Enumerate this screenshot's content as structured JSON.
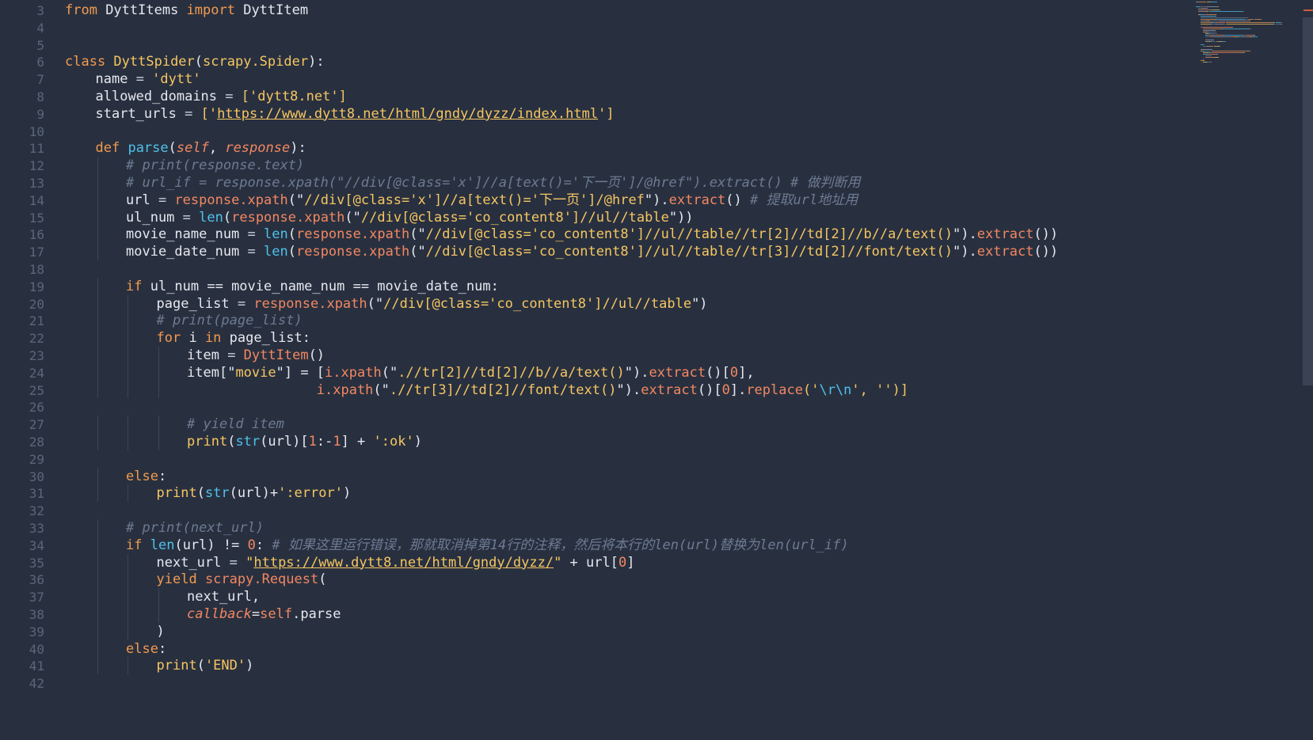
{
  "editor": {
    "language": "python",
    "theme_colors": {
      "background": "#283040",
      "keyword": "#f39a4c",
      "string": "#f6c660",
      "function": "#4fc1e9",
      "comment": "#6d7a91",
      "number": "#f38760",
      "line_number": "#5b6679"
    },
    "lines": [
      {
        "n": "3",
        "tokens": [
          {
            "t": "from",
            "c": "kw"
          },
          {
            "t": " DyttItems ",
            "c": "plain"
          },
          {
            "t": "import",
            "c": "kw"
          },
          {
            "t": " DyttItem",
            "c": "plain"
          }
        ]
      },
      {
        "n": "4",
        "tokens": []
      },
      {
        "n": "5",
        "tokens": []
      },
      {
        "n": "6",
        "tokens": [
          {
            "t": "class",
            "c": "kw"
          },
          {
            "t": " DyttSpider",
            "c": "cls"
          },
          {
            "t": "(",
            "c": "plain"
          },
          {
            "t": "scrapy.Spider",
            "c": "cls"
          },
          {
            "t": "):",
            "c": "plain"
          }
        ]
      },
      {
        "n": "7",
        "indent": 1,
        "tokens": [
          {
            "t": "name",
            "c": "plain"
          },
          {
            "t": " = ",
            "c": "op"
          },
          {
            "t": "'dytt'",
            "c": "str"
          }
        ]
      },
      {
        "n": "8",
        "indent": 1,
        "tokens": [
          {
            "t": "allowed_domains",
            "c": "plain"
          },
          {
            "t": " = ",
            "c": "op"
          },
          {
            "t": "['",
            "c": "str"
          },
          {
            "t": "dytt8.net",
            "c": "str"
          },
          {
            "t": "']",
            "c": "str"
          }
        ]
      },
      {
        "n": "9",
        "indent": 1,
        "tokens": [
          {
            "t": "start_urls",
            "c": "plain"
          },
          {
            "t": " = ",
            "c": "op"
          },
          {
            "t": "['",
            "c": "str"
          },
          {
            "t": "https://www.dytt8.net/html/gndy/dyzz/index.html",
            "c": "url"
          },
          {
            "t": "']",
            "c": "str"
          }
        ]
      },
      {
        "n": "10",
        "tokens": []
      },
      {
        "n": "11",
        "indent": 1,
        "tokens": [
          {
            "t": "def",
            "c": "kw"
          },
          {
            "t": " parse",
            "c": "fn"
          },
          {
            "t": "(",
            "c": "plain"
          },
          {
            "t": "self",
            "c": "self"
          },
          {
            "t": ", ",
            "c": "plain"
          },
          {
            "t": "response",
            "c": "self"
          },
          {
            "t": "):",
            "c": "plain"
          }
        ]
      },
      {
        "n": "12",
        "indent": 2,
        "tokens": [
          {
            "t": "# print(response.text)",
            "c": "cm"
          }
        ]
      },
      {
        "n": "13",
        "indent": 2,
        "tokens": [
          {
            "t": "# url_if = response.xpath(\"//div[@class='x']//a[text()='下一页']/@href\").extract() # 做判断用",
            "c": "cm"
          }
        ]
      },
      {
        "n": "14",
        "indent": 2,
        "tokens": [
          {
            "t": "url",
            "c": "plain"
          },
          {
            "t": " = ",
            "c": "op"
          },
          {
            "t": "response.xpath",
            "c": "call"
          },
          {
            "t": "(\"",
            "c": "plain"
          },
          {
            "t": "//div[@class='x']//a[text()='下一页']/@href",
            "c": "str"
          },
          {
            "t": "\").",
            "c": "plain"
          },
          {
            "t": "extract",
            "c": "call"
          },
          {
            "t": "() ",
            "c": "plain"
          },
          {
            "t": "# 提取url地址用",
            "c": "cm"
          }
        ]
      },
      {
        "n": "15",
        "indent": 2,
        "tokens": [
          {
            "t": "ul_num",
            "c": "plain"
          },
          {
            "t": " = ",
            "c": "op"
          },
          {
            "t": "len",
            "c": "bi"
          },
          {
            "t": "(",
            "c": "plain"
          },
          {
            "t": "response.xpath",
            "c": "call"
          },
          {
            "t": "(\"",
            "c": "plain"
          },
          {
            "t": "//div[@class='co_content8']//ul//table",
            "c": "str"
          },
          {
            "t": "\"))",
            "c": "plain"
          }
        ]
      },
      {
        "n": "16",
        "indent": 2,
        "tokens": [
          {
            "t": "movie_name_num",
            "c": "plain"
          },
          {
            "t": " = ",
            "c": "op"
          },
          {
            "t": "len",
            "c": "bi"
          },
          {
            "t": "(",
            "c": "plain"
          },
          {
            "t": "response.xpath",
            "c": "call"
          },
          {
            "t": "(\"",
            "c": "plain"
          },
          {
            "t": "//div[@class='co_content8']//ul//table//tr[2]//td[2]//b//a/text()",
            "c": "str"
          },
          {
            "t": "\").",
            "c": "plain"
          },
          {
            "t": "extract",
            "c": "call"
          },
          {
            "t": "())",
            "c": "plain"
          }
        ]
      },
      {
        "n": "17",
        "indent": 2,
        "tokens": [
          {
            "t": "movie_date_num",
            "c": "plain"
          },
          {
            "t": " = ",
            "c": "op"
          },
          {
            "t": "len",
            "c": "bi"
          },
          {
            "t": "(",
            "c": "plain"
          },
          {
            "t": "response.xpath",
            "c": "call"
          },
          {
            "t": "(\"",
            "c": "plain"
          },
          {
            "t": "//div[@class='co_content8']//ul//table//tr[3]//td[2]//font/text()",
            "c": "str"
          },
          {
            "t": "\").",
            "c": "plain"
          },
          {
            "t": "extract",
            "c": "call"
          },
          {
            "t": "())",
            "c": "plain"
          }
        ]
      },
      {
        "n": "18",
        "tokens": []
      },
      {
        "n": "19",
        "indent": 2,
        "tokens": [
          {
            "t": "if",
            "c": "kw"
          },
          {
            "t": " ul_num == movie_name_num == movie_date_num:",
            "c": "plain"
          }
        ]
      },
      {
        "n": "20",
        "indent": 3,
        "tokens": [
          {
            "t": "page_list",
            "c": "plain"
          },
          {
            "t": " = ",
            "c": "op"
          },
          {
            "t": "response.xpath",
            "c": "call"
          },
          {
            "t": "(\"",
            "c": "plain"
          },
          {
            "t": "//div[@class='co_content8']//ul//table",
            "c": "str"
          },
          {
            "t": "\")",
            "c": "plain"
          }
        ]
      },
      {
        "n": "21",
        "indent": 3,
        "tokens": [
          {
            "t": "# print(page_list)",
            "c": "cm"
          }
        ]
      },
      {
        "n": "22",
        "indent": 3,
        "tokens": [
          {
            "t": "for",
            "c": "kw"
          },
          {
            "t": " i ",
            "c": "plain"
          },
          {
            "t": "in",
            "c": "kw"
          },
          {
            "t": " page_list:",
            "c": "plain"
          }
        ]
      },
      {
        "n": "23",
        "indent": 4,
        "tokens": [
          {
            "t": "item",
            "c": "plain"
          },
          {
            "t": " = ",
            "c": "op"
          },
          {
            "t": "DyttItem",
            "c": "call"
          },
          {
            "t": "()",
            "c": "plain"
          }
        ]
      },
      {
        "n": "24",
        "indent": 4,
        "tokens": [
          {
            "t": "item",
            "c": "plain"
          },
          {
            "t": "[\"",
            "c": "plain"
          },
          {
            "t": "movie",
            "c": "str"
          },
          {
            "t": "\"] = [",
            "c": "plain"
          },
          {
            "t": "i.xpath",
            "c": "call"
          },
          {
            "t": "(\"",
            "c": "plain"
          },
          {
            "t": ".//tr[2]//td[2]//b//a/text()",
            "c": "str"
          },
          {
            "t": "\").",
            "c": "plain"
          },
          {
            "t": "extract",
            "c": "call"
          },
          {
            "t": "()[",
            "c": "plain"
          },
          {
            "t": "0",
            "c": "num"
          },
          {
            "t": "],",
            "c": "plain"
          }
        ]
      },
      {
        "n": "25",
        "indent": 4,
        "extra": "                ",
        "tokens": [
          {
            "t": "i.xpath",
            "c": "call"
          },
          {
            "t": "(\"",
            "c": "plain"
          },
          {
            "t": ".//tr[3]//td[2]//font/text()",
            "c": "str"
          },
          {
            "t": "\").",
            "c": "plain"
          },
          {
            "t": "extract",
            "c": "call"
          },
          {
            "t": "()[",
            "c": "plain"
          },
          {
            "t": "0",
            "c": "num"
          },
          {
            "t": "].",
            "c": "plain"
          },
          {
            "t": "replace",
            "c": "call"
          },
          {
            "t": "('",
            "c": "str"
          },
          {
            "t": "\\r\\n",
            "c": "esc"
          },
          {
            "t": "', '')]",
            "c": "str"
          }
        ]
      },
      {
        "n": "26",
        "tokens": []
      },
      {
        "n": "27",
        "indent": 4,
        "tokens": [
          {
            "t": "# yield item",
            "c": "cm"
          }
        ]
      },
      {
        "n": "28",
        "indent": 4,
        "tokens": [
          {
            "t": "print",
            "c": "str"
          },
          {
            "t": "(",
            "c": "plain"
          },
          {
            "t": "str",
            "c": "bi"
          },
          {
            "t": "(url)[",
            "c": "plain"
          },
          {
            "t": "1",
            "c": "num"
          },
          {
            "t": ":-",
            "c": "plain"
          },
          {
            "t": "1",
            "c": "num"
          },
          {
            "t": "] + ",
            "c": "plain"
          },
          {
            "t": "':ok'",
            "c": "str"
          },
          {
            "t": ")",
            "c": "plain"
          }
        ]
      },
      {
        "n": "29",
        "tokens": []
      },
      {
        "n": "30",
        "indent": 2,
        "tokens": [
          {
            "t": "else",
            "c": "kw"
          },
          {
            "t": ":",
            "c": "plain"
          }
        ]
      },
      {
        "n": "31",
        "indent": 3,
        "tokens": [
          {
            "t": "print",
            "c": "str"
          },
          {
            "t": "(",
            "c": "plain"
          },
          {
            "t": "str",
            "c": "bi"
          },
          {
            "t": "(url)+",
            "c": "plain"
          },
          {
            "t": "':error'",
            "c": "str"
          },
          {
            "t": ")",
            "c": "plain"
          }
        ]
      },
      {
        "n": "32",
        "tokens": []
      },
      {
        "n": "33",
        "indent": 2,
        "tokens": [
          {
            "t": "# print(next_url)",
            "c": "cm"
          }
        ]
      },
      {
        "n": "34",
        "indent": 2,
        "tokens": [
          {
            "t": "if",
            "c": "kw"
          },
          {
            "t": " ",
            "c": "plain"
          },
          {
            "t": "len",
            "c": "bi"
          },
          {
            "t": "(url) != ",
            "c": "plain"
          },
          {
            "t": "0",
            "c": "num"
          },
          {
            "t": ": ",
            "c": "plain"
          },
          {
            "t": "# 如果这里运行错误，那就取消掉第14行的注释，然后将本行的len(url)替换为len(url_if)",
            "c": "cm"
          }
        ]
      },
      {
        "n": "35",
        "indent": 3,
        "tokens": [
          {
            "t": "next_url",
            "c": "plain"
          },
          {
            "t": " = ",
            "c": "op"
          },
          {
            "t": "\"",
            "c": "str"
          },
          {
            "t": "https://www.dytt8.net/html/gndy/dyzz/",
            "c": "url"
          },
          {
            "t": "\"",
            "c": "str"
          },
          {
            "t": " + url[",
            "c": "plain"
          },
          {
            "t": "0",
            "c": "num"
          },
          {
            "t": "]",
            "c": "plain"
          }
        ]
      },
      {
        "n": "36",
        "indent": 3,
        "tokens": [
          {
            "t": "yield",
            "c": "kw"
          },
          {
            "t": " ",
            "c": "plain"
          },
          {
            "t": "scrapy.Request",
            "c": "call"
          },
          {
            "t": "(",
            "c": "plain"
          }
        ]
      },
      {
        "n": "37",
        "indent": 4,
        "tokens": [
          {
            "t": "next_url,",
            "c": "plain"
          }
        ]
      },
      {
        "n": "38",
        "indent": 4,
        "tokens": [
          {
            "t": "callback",
            "c": "param"
          },
          {
            "t": "=",
            "c": "plain"
          },
          {
            "t": "self",
            "c": "selfn"
          },
          {
            "t": ".parse",
            "c": "plain"
          }
        ]
      },
      {
        "n": "39",
        "indent": 3,
        "tokens": [
          {
            "t": ")",
            "c": "plain"
          }
        ]
      },
      {
        "n": "40",
        "indent": 2,
        "tokens": [
          {
            "t": "else",
            "c": "kw"
          },
          {
            "t": ":",
            "c": "plain"
          }
        ]
      },
      {
        "n": "41",
        "indent": 3,
        "extra": "",
        "tokens": [
          {
            "t": "print",
            "c": "str"
          },
          {
            "t": "(",
            "c": "plain"
          },
          {
            "t": "'END'",
            "c": "str"
          },
          {
            "t": ")",
            "c": "plain"
          }
        ]
      },
      {
        "n": "42",
        "tokens": []
      }
    ]
  }
}
